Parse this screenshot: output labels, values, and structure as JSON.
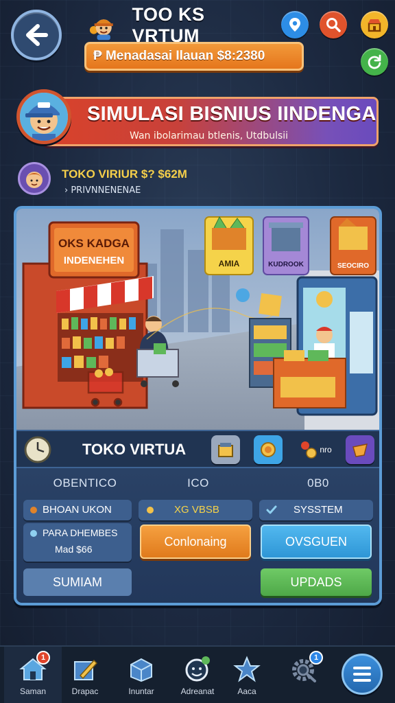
{
  "header": {
    "title": "TOO KS VRTUM",
    "money": "₱ Menadasai  Ilauan $8:2380",
    "icons": [
      "location-pin-icon",
      "search-icon",
      "shop-icon",
      "refresh-icon"
    ]
  },
  "banner": {
    "title": "SIMULASI BISNIUS IINDENGA",
    "subtitle": "Wan ibolarimau btlenis, Utdbulsii"
  },
  "shop_info": {
    "line1": "TOKO VIRIUR $? $62M",
    "line2": "› PRIVNNENENAE"
  },
  "scene": {
    "store_sign_1": "OKS KADGA",
    "store_sign_2": "INDENEHEN",
    "card_1": "AMIA",
    "card_2": "KUDROOK",
    "card_3": "SEOCIRO"
  },
  "info_row": {
    "shop_name": "TOKO VIRTUA",
    "right_label": "nro"
  },
  "controls": {
    "col1_head": "OBENTICO",
    "col2_head": "ICO",
    "col3_head": "0B0",
    "item_1": "BHOAN UKON",
    "item_2a": "PARA DHEMBES",
    "item_2b": "Mad $66",
    "item_3": "XG VBSB",
    "item_4": "SYSSTEM",
    "btn_orange": "Conlonaing",
    "btn_blue": "OVSGUEN",
    "btn_left": "SUMIAM",
    "btn_green": "UPDADS"
  },
  "nav": {
    "items": [
      {
        "label": "Saman",
        "icon": "home-icon",
        "badge": "1"
      },
      {
        "label": "Drapac",
        "icon": "pencil-icon",
        "badge": ""
      },
      {
        "label": "Inuntar",
        "icon": "box-icon",
        "badge": ""
      },
      {
        "label": "Adreanat",
        "icon": "smile-icon",
        "badge": ""
      },
      {
        "label": "Aaca",
        "icon": "star-icon",
        "badge": ""
      },
      {
        "label": "",
        "icon": "settings-search-icon",
        "badge": "1"
      }
    ]
  },
  "colors": {
    "accent_orange": "#e5761c",
    "accent_green": "#5fb85a",
    "accent_blue": "#3ea5e6",
    "panel_border": "#5c9cd6"
  }
}
